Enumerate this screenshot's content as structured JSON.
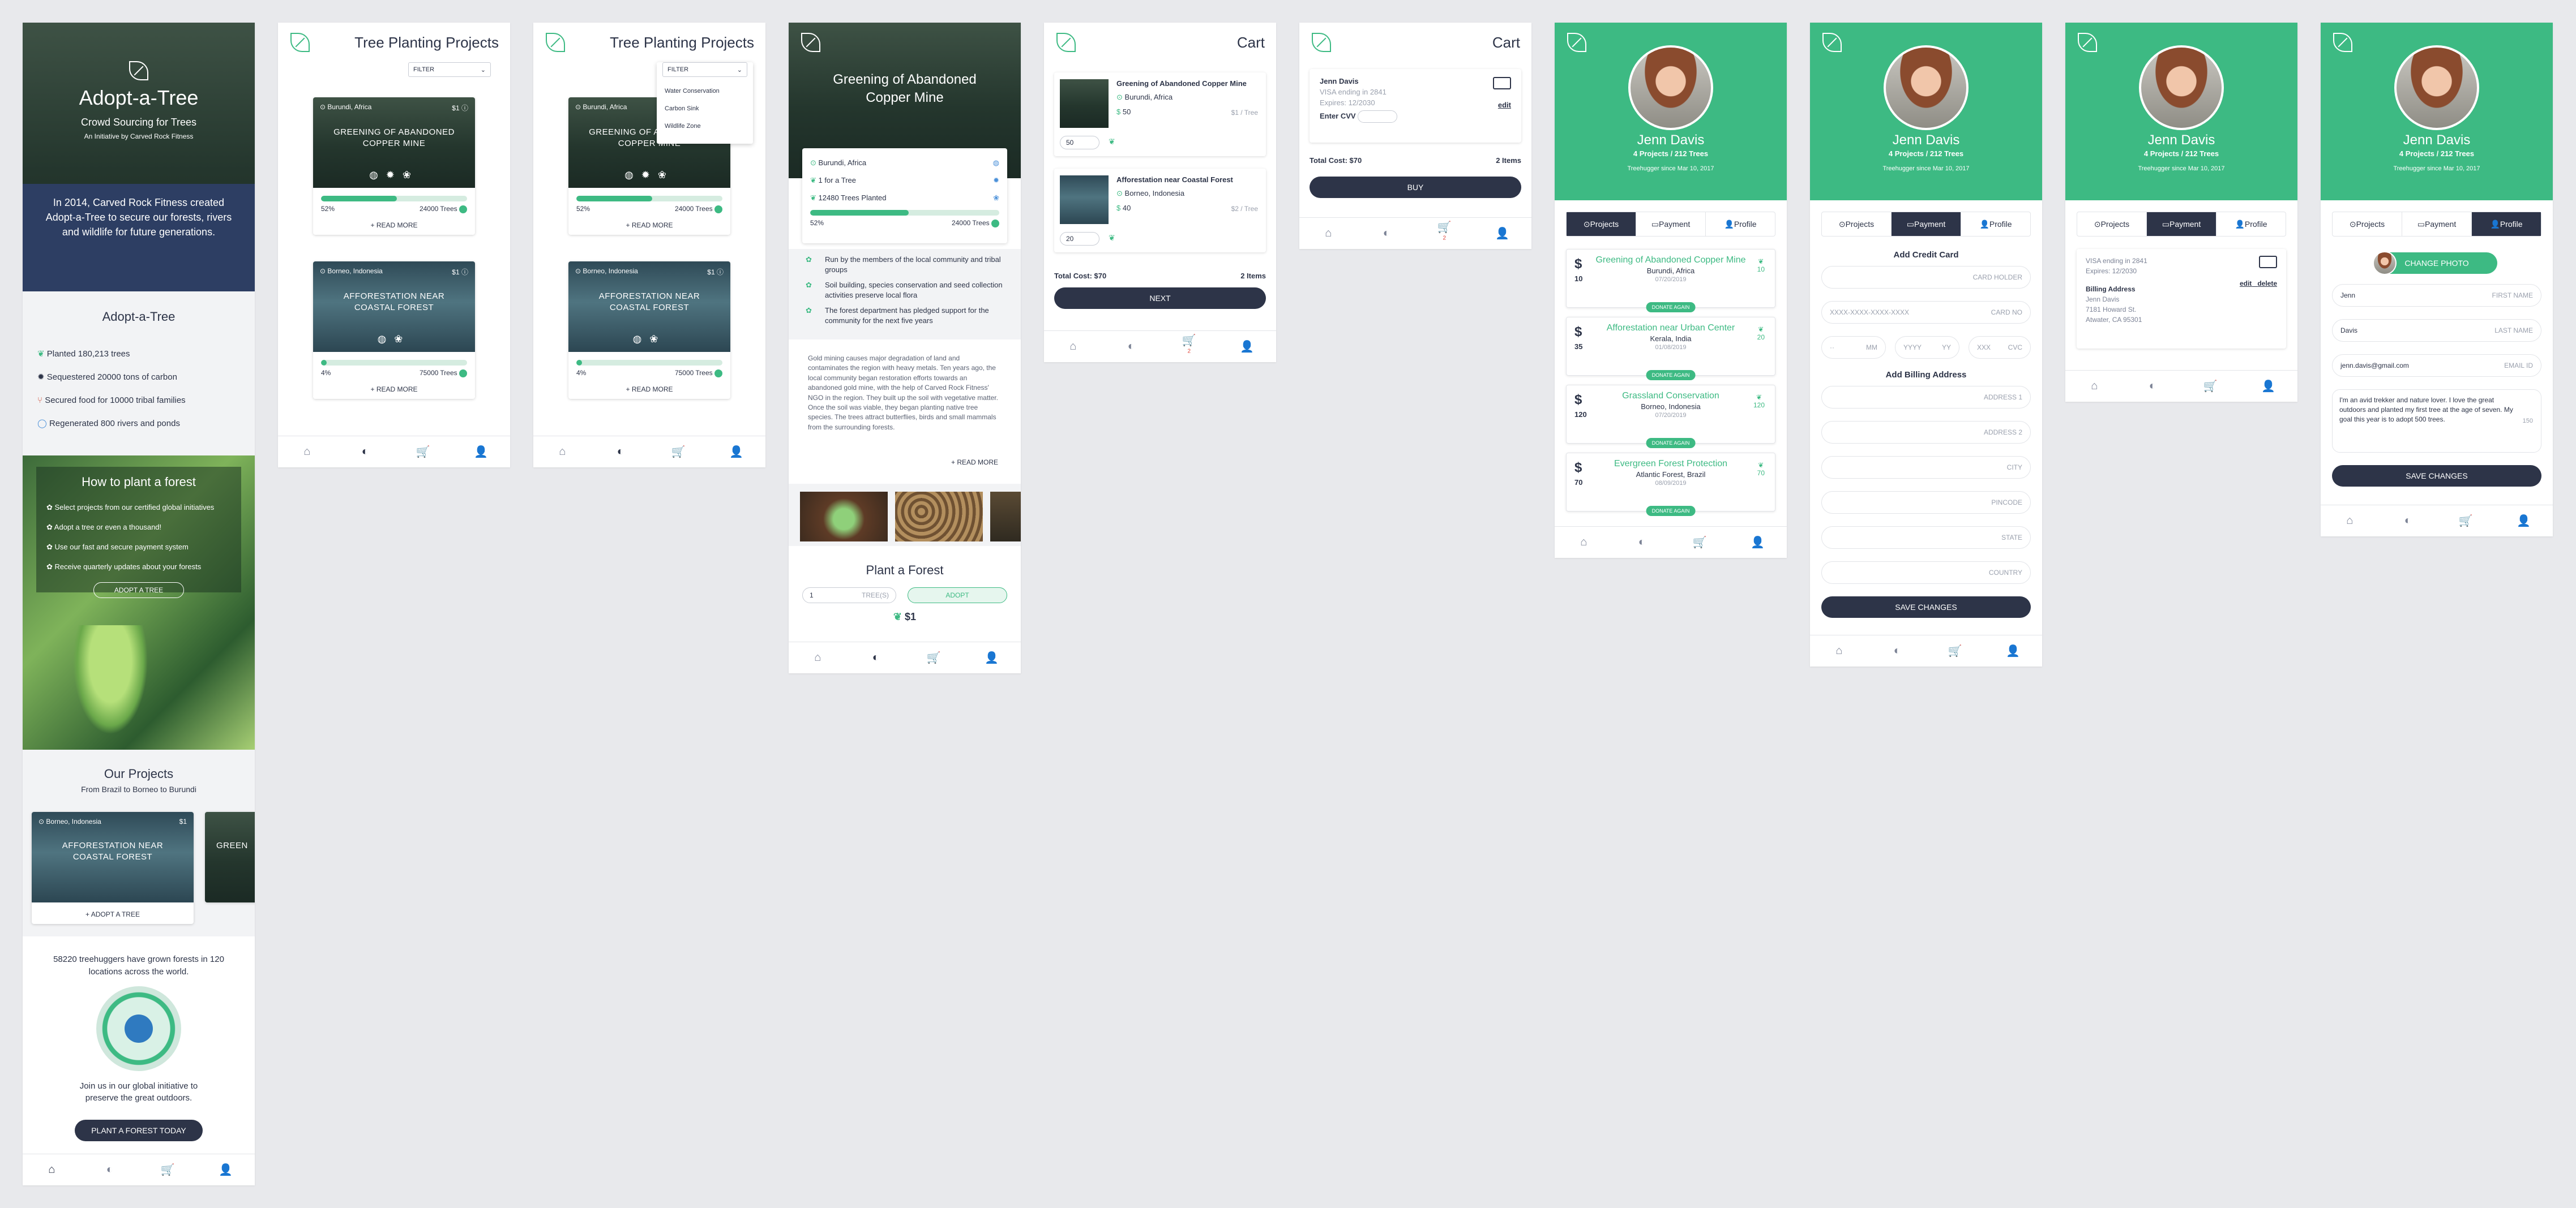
{
  "landing": {
    "brand": "Adopt-a-Tree",
    "tagline": "Crowd Sourcing for Trees",
    "initiative": "An Initiative by Carved Rock Fitness",
    "intro": "In 2014, Carved Rock Fitness created Adopt-a-Tree to secure our forests, rivers and wildlife for future generations.",
    "section_title": "Adopt-a-Tree",
    "stats": [
      "Planted 180,213 trees",
      "Sequestered 20000 tons of carbon",
      "Secured food for 10000 tribal families",
      "Regenerated 800 rivers and ponds"
    ],
    "how_title": "How to plant a forest",
    "steps": [
      "Select projects from our certified global initiatives",
      "Adopt a tree or even a thousand!",
      "Use our fast and secure payment system",
      "Receive quarterly updates about your forests"
    ],
    "adopt_btn": "ADOPT A TREE",
    "projects_title": "Our Projects",
    "projects_sub": "From Brazil to Borneo to Burundi",
    "card_loc": "Borneo, Indonesia",
    "card_price": "$1",
    "card_title": "AFFORESTATION NEAR COASTAL FOREST",
    "card_adopt": "+ ADOPT A TREE",
    "card2_title": "GREEN",
    "impact": "58220 treehuggers have grown forests in 120 locations across the world.",
    "join": "Join us in our global initiative to preserve the great outdoors.",
    "cta": "PLANT A FOREST TODAY"
  },
  "projects": {
    "title": "Tree Planting Projects",
    "filter": "FILTER",
    "filter_options": [
      "Water Conservation",
      "Carbon Sink",
      "Wildlife Zone"
    ],
    "items": [
      {
        "loc": "Burundi, Africa",
        "price": "$1",
        "title": "GREENING OF ABANDONED COPPER MINE",
        "pct": "52%",
        "goal": "24000 Trees",
        "progress": 0.52
      },
      {
        "loc": "Borneo, Indonesia",
        "price": "$1",
        "title": "AFFORESTATION NEAR COASTAL FOREST",
        "pct": "4%",
        "goal": "75000 Trees",
        "progress": 0.04
      }
    ],
    "read_more": "+ READ MORE"
  },
  "detail": {
    "title": "Greening of Abandoned Copper Mine",
    "loc": "Burundi, Africa",
    "rate": "1 for a Tree",
    "planted": "12480 Trees Planted",
    "pct": "52%",
    "goal": "24000 Trees",
    "progress": 0.52,
    "bullets": [
      "Run by the members of the local community and tribal groups",
      "Soil building, species conservation and seed collection activities preserve local flora",
      "The forest department has pledged support for the community for the next five years"
    ],
    "desc": "Gold mining causes major degradation of land and contaminates the region with heavy metals. Ten years ago, the local community began restoration efforts towards an abandoned gold mine, with the help of Carved Rock Fitness' NGO in the region. They built up the soil with vegetative matter. Once the soil was viable, they began planting native tree species. The trees attract butterflies, birds and small mammals from the surrounding forests.",
    "read_more": "+ READ MORE",
    "plant_title": "Plant a Forest",
    "qty": "1",
    "qty_unit": "TREE(S)",
    "adopt": "ADOPT",
    "total": "$1"
  },
  "cart": {
    "title": "Cart",
    "items": [
      {
        "name": "Greening of Abandoned Copper Mine",
        "loc": "Burundi, Africa",
        "amount": "50",
        "rate": "$1 / Tree",
        "qty": "50"
      },
      {
        "name": "Afforestation near Coastal Forest",
        "loc": "Borneo, Indonesia",
        "amount": "40",
        "rate": "$2 / Tree",
        "qty": "20"
      }
    ],
    "total": "Total Cost: $70",
    "count": "2 Items",
    "next": "NEXT",
    "badge": "2"
  },
  "checkout": {
    "title": "Cart",
    "name": "Jenn Davis",
    "card": "VISA ending in 2841",
    "expires": "Expires: 12/2030",
    "cvv_label": "Enter CVV",
    "edit": "edit",
    "total": "Total Cost: $70",
    "count": "2 Items",
    "buy": "BUY"
  },
  "profile": {
    "name": "Jenn Davis",
    "stats": "4 Projects / 212 Trees",
    "since": "Treehugger since Mar 10, 2017",
    "tabs": [
      "Projects",
      "Payment",
      "Profile"
    ],
    "projects": [
      {
        "title": "Greening of Abandoned Copper Mine",
        "loc": "Burundi, Africa",
        "date": "07/20/2019",
        "amount": "10",
        "trees": "10"
      },
      {
        "title": "Afforestation near Urban Center",
        "loc": "Kerala, India",
        "date": "01/08/2019",
        "amount": "35",
        "trees": "20"
      },
      {
        "title": "Grassland Conservation",
        "loc": "Borneo, Indonesia",
        "date": "07/20/2019",
        "amount": "120",
        "trees": "120"
      },
      {
        "title": "Evergreen Forest Protection",
        "loc": "Atlantic Forest, Brazil",
        "date": "08/09/2019",
        "amount": "70",
        "trees": "70"
      }
    ],
    "donate": "DONATE AGAIN",
    "add_card": "Add Credit Card",
    "card_holder": "CARD HOLDER",
    "card_no_ph": "XXXX-XXXX-XXXX-XXXX",
    "card_no": "CARD NO",
    "mm": "MM",
    "yy": "YY",
    "yyyy": "YYYY",
    "xxx": "XXX",
    "cvc": "CVC",
    "add_billing": "Add Billing Address",
    "addr_fields": [
      "ADDRESS 1",
      "ADDRESS 2",
      "CITY",
      "PINCODE",
      "STATE",
      "COUNTRY"
    ],
    "save": "SAVE CHANGES",
    "visa": "VISA ending in 2841",
    "expires": "Expires: 12/2030",
    "edit": "edit",
    "delete": "delete",
    "billing_title": "Billing Address",
    "billing": [
      "Jenn Davis",
      "7181 Howard St.",
      "Atwater, CA 95301"
    ],
    "change_photo": "CHANGE PHOTO",
    "first": "Jenn",
    "first_label": "FIRST NAME",
    "last": "Davis",
    "last_label": "LAST NAME",
    "email": "jenn.davis@gmail.com",
    "email_label": "EMAIL ID",
    "bio": "I'm an avid trekker and nature lover. I love the great outdoors and planted my first tree at the age of seven. My goal this year is to adopt 500 trees.",
    "bio_count": "150"
  },
  "nav": {
    "home": "⌂",
    "projects": "◐",
    "cart": "🛒",
    "profile": "👤"
  }
}
